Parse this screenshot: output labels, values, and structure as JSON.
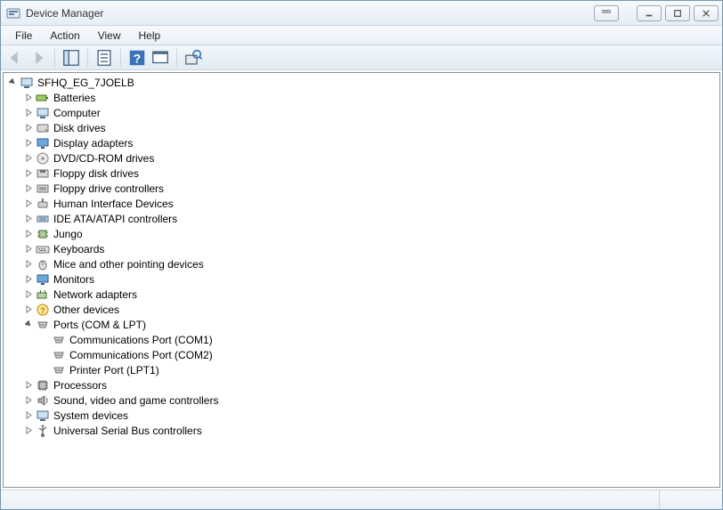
{
  "window": {
    "title": "Device Manager"
  },
  "menu": {
    "file": "File",
    "action": "Action",
    "view": "View",
    "help": "Help"
  },
  "tree": {
    "root": "SFHQ_EG_7JOELB",
    "batteries": "Batteries",
    "computer": "Computer",
    "disk_drives": "Disk drives",
    "display_adapters": "Display adapters",
    "dvd_cdrom": "DVD/CD-ROM drives",
    "floppy_drives": "Floppy disk drives",
    "floppy_ctrl": "Floppy drive controllers",
    "hid": "Human Interface Devices",
    "ide": "IDE ATA/ATAPI controllers",
    "jungo": "Jungo",
    "keyboards": "Keyboards",
    "mice": "Mice and other pointing devices",
    "monitors": "Monitors",
    "network": "Network adapters",
    "other": "Other devices",
    "ports": "Ports (COM & LPT)",
    "com1": "Communications Port (COM1)",
    "com2": "Communications Port (COM2)",
    "lpt1": "Printer Port (LPT1)",
    "processors": "Processors",
    "sound": "Sound, video and game controllers",
    "system": "System devices",
    "usb": "Universal Serial Bus controllers"
  }
}
